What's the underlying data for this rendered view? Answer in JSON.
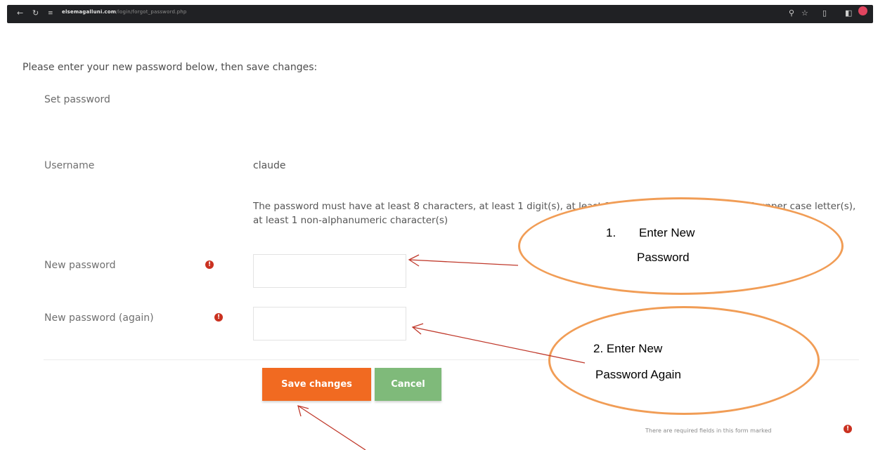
{
  "browser": {
    "back_icon": "arrow-left-icon",
    "reload_icon": "reload-icon",
    "url_host": "elsemagalluni.com",
    "url_path": "/login/forgot_password.php",
    "right_icons": [
      "search-icon",
      "star-icon",
      "extension-icon",
      "sidebar-icon",
      "profile-avatar-icon"
    ]
  },
  "page": {
    "instructions": "Please enter your new password below, then save changes:",
    "section_title": "Set password",
    "username_label": "Username",
    "username_value": "claude",
    "password_rules": "The password must have at least 8 characters, at least 1 digit(s), at least 1 lower case letter(s), at least 1 upper case letter(s), at least 1 non-alphanumeric character(s)",
    "new_password_label": "New password",
    "new_password_again_label": "New password (again)",
    "required_icon": "exclamation-circle-icon",
    "new_password_value": "",
    "new_password_again_value": "",
    "save_button": "Save changes",
    "cancel_button": "Cancel",
    "required_note": "There are required fields in this form marked"
  },
  "annotations": {
    "step1_number": "1.",
    "step1_line1": "Enter New",
    "step1_line2": "Password",
    "step2_line1": "2. Enter New",
    "step2_line2": "Password Again",
    "arrow_color": "#c0392b",
    "callout_border_color": "#f19d56"
  },
  "colors": {
    "save_button": "#f16a21",
    "cancel_button": "#7fba7a",
    "required_icon": "#ca3120",
    "browser_bar": "#202124"
  }
}
